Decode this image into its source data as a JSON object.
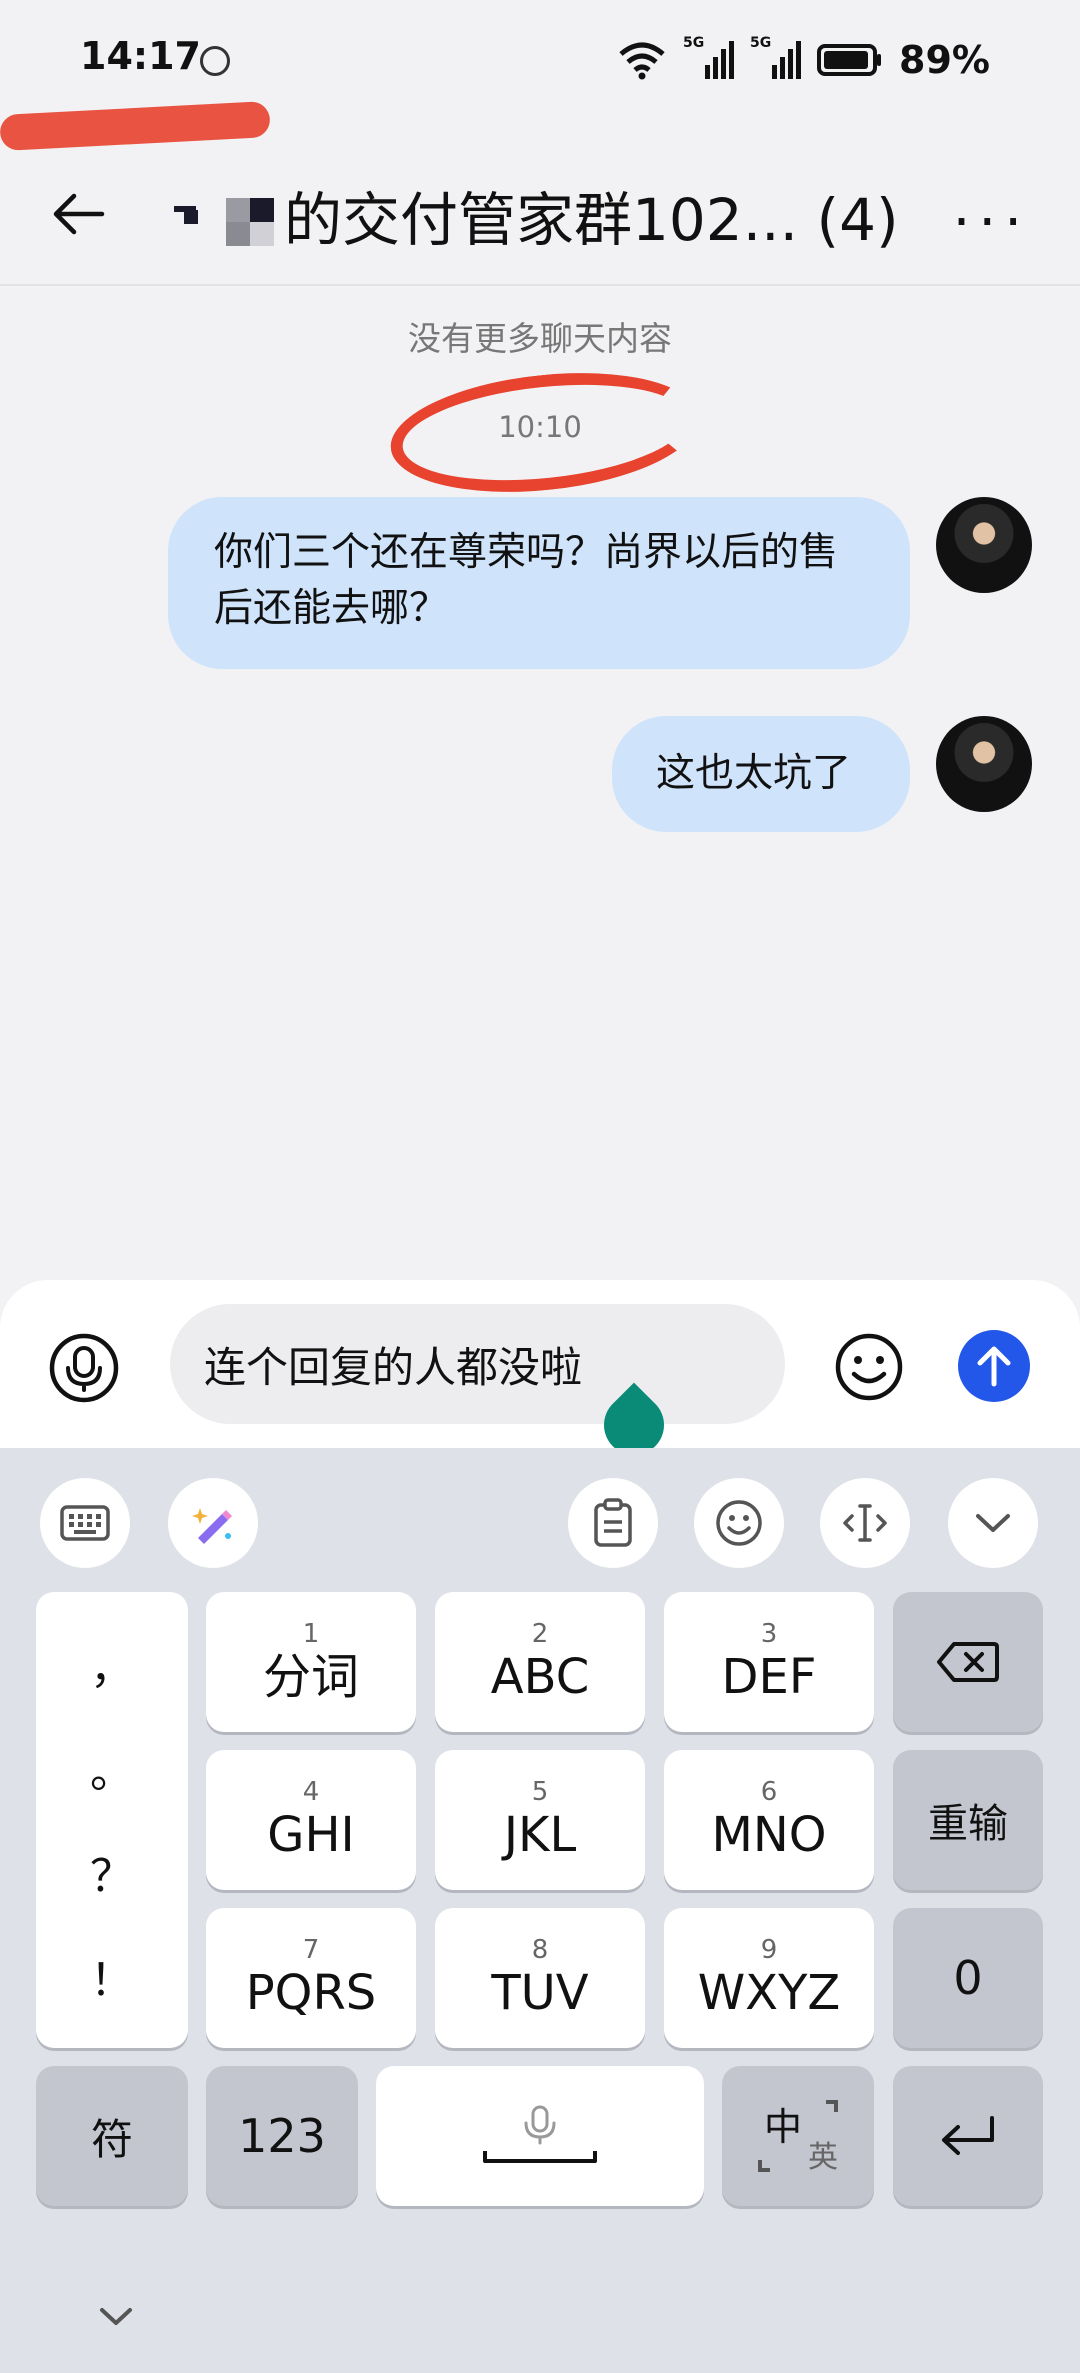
{
  "status_bar": {
    "time": "14:17",
    "battery": "89%",
    "network_labels": [
      "5G",
      "5G"
    ]
  },
  "header": {
    "title": "的交付管家群102... (4)",
    "more": "···"
  },
  "chat": {
    "no_more": "没有更多聊天内容",
    "timestamp": "10:10",
    "messages": [
      {
        "text": "你们三个还在尊荣吗？尚界以后的售后还能去哪？"
      },
      {
        "text": "这也太坑了"
      }
    ]
  },
  "input": {
    "value": "连个回复的人都没啦"
  },
  "keyboard": {
    "punctuation": [
      "，",
      "。",
      "？",
      "！"
    ],
    "keys": [
      {
        "num": "1",
        "label": "分词"
      },
      {
        "num": "2",
        "label": "ABC"
      },
      {
        "num": "3",
        "label": "DEF"
      },
      {
        "num": "4",
        "label": "GHI"
      },
      {
        "num": "5",
        "label": "JKL"
      },
      {
        "num": "6",
        "label": "MNO"
      },
      {
        "num": "7",
        "label": "PQRS"
      },
      {
        "num": "8",
        "label": "TUV"
      },
      {
        "num": "9",
        "label": "WXYZ"
      }
    ],
    "reinput": "重输",
    "zero": "0",
    "symbol": "符",
    "numbers": "123",
    "lang_main": "中",
    "lang_sub": "英"
  },
  "colors": {
    "bubble": "#cfe3fb",
    "send": "#2357ea",
    "annotation": "#e8432f",
    "cursor_drop": "#0a8b77"
  }
}
